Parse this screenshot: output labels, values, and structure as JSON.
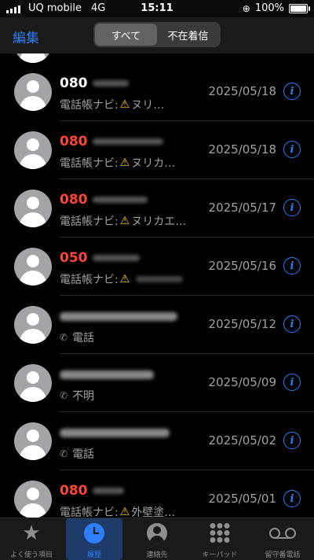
{
  "status": {
    "carrier": "UQ mobile",
    "network": "4G",
    "time": "15:11",
    "battery": "100%",
    "battery_level": 1.0
  },
  "nav": {
    "edit_label": "編集",
    "segments": [
      "すべて",
      "不在着信"
    ],
    "active_segment": 0
  },
  "calls": [
    {
      "name": "080",
      "missed": false,
      "label": "電話帳ナビ:",
      "warning": true,
      "detail": "ヌリ…",
      "date": "2025/05/18"
    },
    {
      "name": "080",
      "missed": true,
      "label": "電話帳ナビ:",
      "warning": true,
      "detail": "ヌリカ…",
      "date": "2025/05/18"
    },
    {
      "name": "080",
      "missed": true,
      "label": "電話帳ナビ:",
      "warning": true,
      "detail": "ヌリカエ…",
      "date": "2025/05/17"
    },
    {
      "name": "050",
      "missed": true,
      "label": "電話帳ナビ:",
      "warning": true,
      "detail": "",
      "date": "2025/05/16"
    },
    {
      "name": "",
      "missed": false,
      "label": "電話",
      "warning": false,
      "detail": "",
      "date": "2025/05/12"
    },
    {
      "name": "",
      "missed": false,
      "label": "不明",
      "warning": false,
      "detail": "",
      "date": "2025/05/09"
    },
    {
      "name": "",
      "missed": false,
      "label": "電話",
      "warning": false,
      "detail": "",
      "date": "2025/05/02"
    },
    {
      "name": "080",
      "missed": true,
      "label": "電話帳ナビ:",
      "warning": true,
      "detail": "外壁塗…",
      "date": "2025/05/01"
    }
  ],
  "tabs": [
    {
      "label": "よく使う項目",
      "icon": "star-icon"
    },
    {
      "label": "履歴",
      "icon": "clock-icon",
      "active": true
    },
    {
      "label": "連絡先",
      "icon": "person-icon"
    },
    {
      "label": "キーパッド",
      "icon": "keypad-icon"
    },
    {
      "label": "留守番電話",
      "icon": "voicemail-icon"
    }
  ],
  "colors": {
    "accent": "#2d7ff9",
    "missed": "#ff453a",
    "warning": "#ffcc00"
  }
}
